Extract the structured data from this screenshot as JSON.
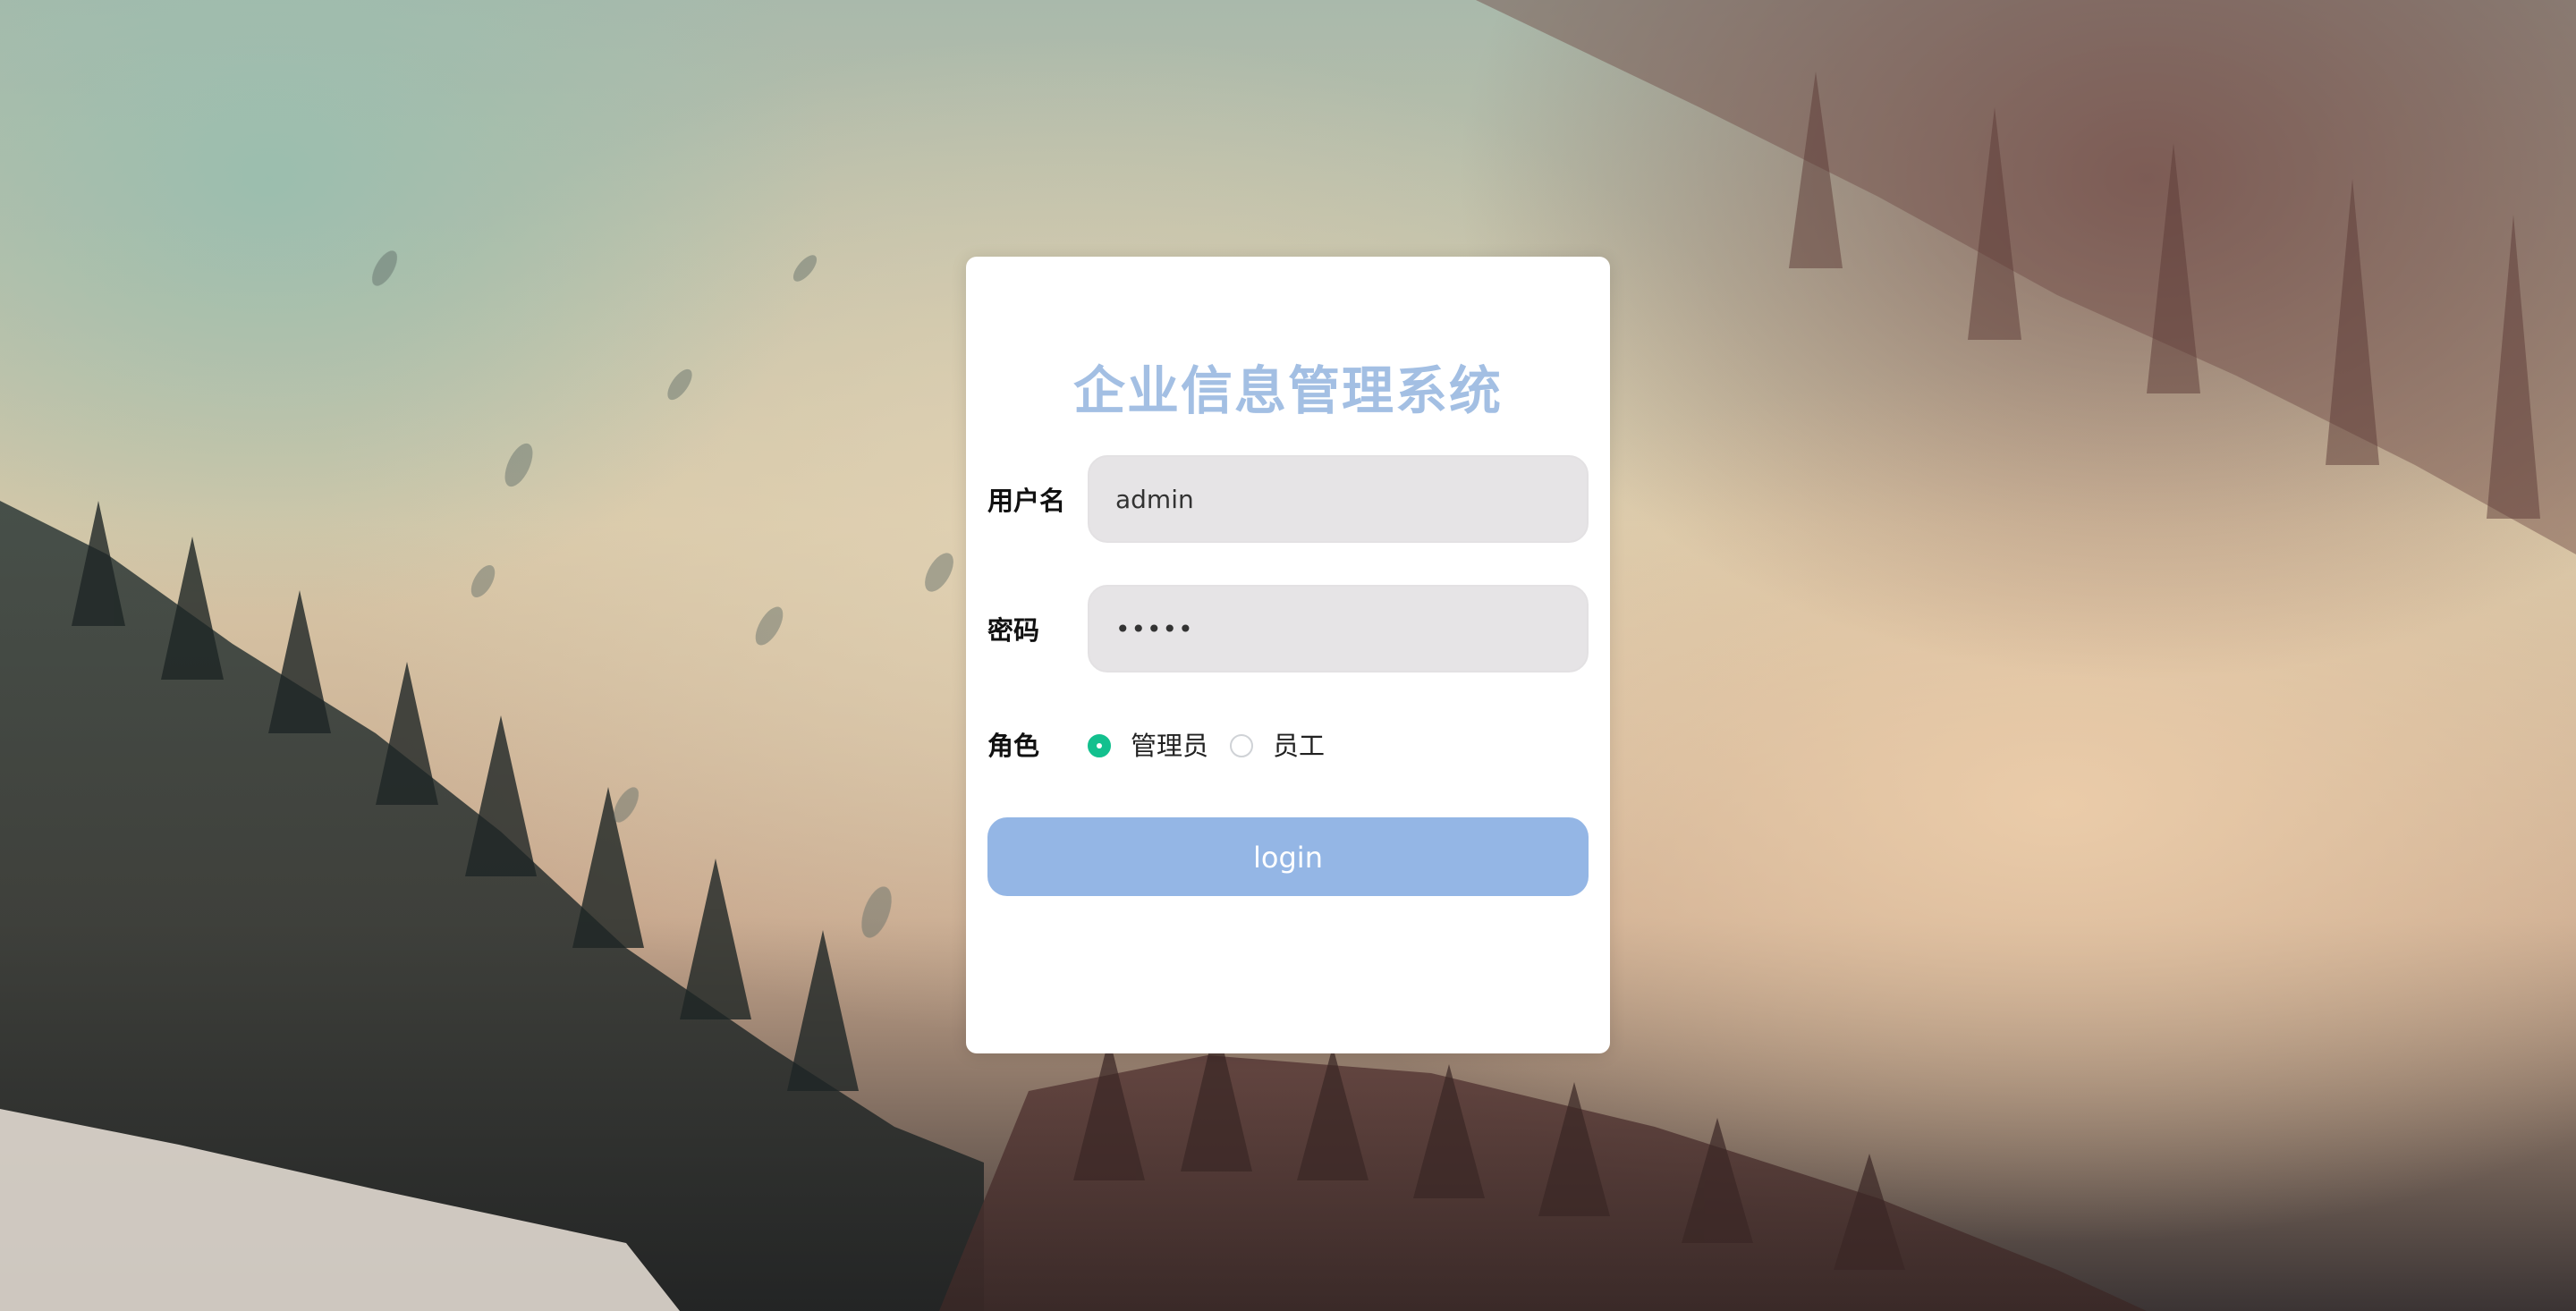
{
  "page": {
    "title": "企业信息管理系统"
  },
  "form": {
    "username": {
      "label": "用户名",
      "value": "admin"
    },
    "password": {
      "label": "密码",
      "value": "•••••"
    },
    "role": {
      "label": "角色",
      "options": [
        {
          "label": "管理员",
          "checked": true
        },
        {
          "label": "员工",
          "checked": false
        }
      ]
    },
    "submit_label": "login"
  },
  "colors": {
    "title": "#a3bfe3",
    "button": "#94b6e5",
    "radio_checked": "#13c08e",
    "field_bg": "#e6e4e6"
  },
  "background": {
    "icon": "misty-forest-landscape"
  }
}
